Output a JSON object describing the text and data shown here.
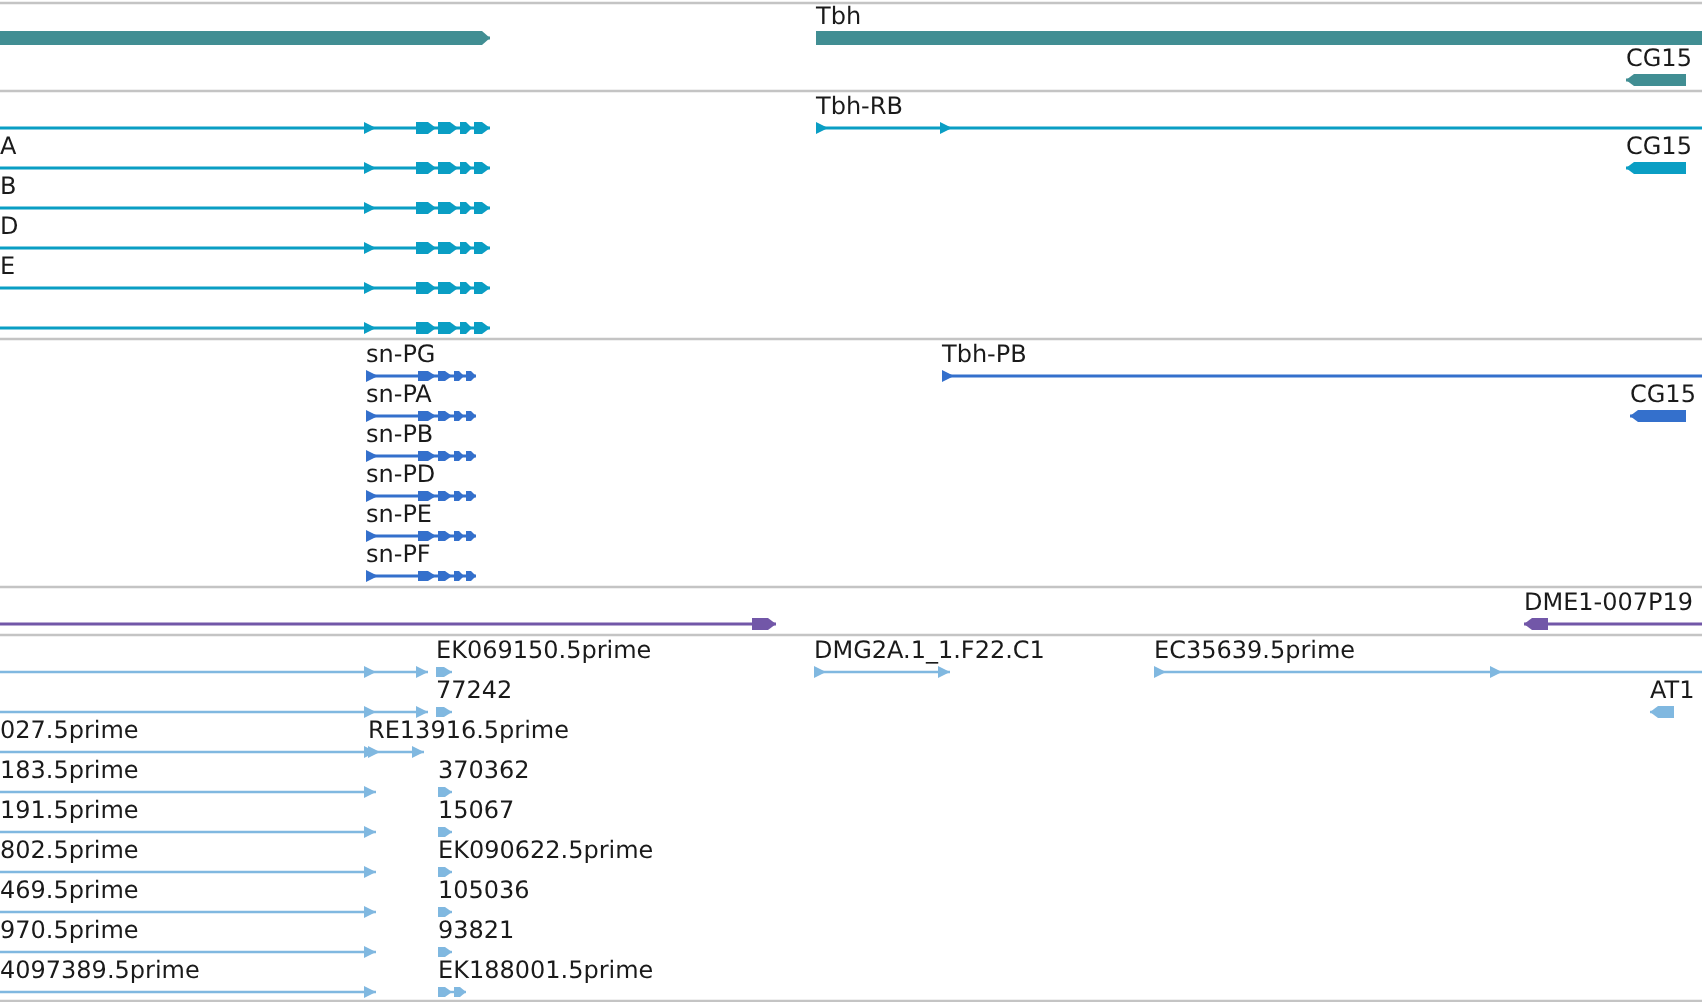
{
  "tracks": [
    {
      "kind": "gene",
      "color": "#418e93",
      "features": [
        {
          "reverse": false
        },
        {
          "label": "Tbh",
          "reverse": false
        },
        {
          "label": "CG15",
          "reverse": true
        }
      ]
    },
    {
      "kind": "transcript",
      "color": "#0a9ec4",
      "features": [
        {
          "reverse": false
        },
        {
          "label": "A",
          "reverse": false
        },
        {
          "label": "B",
          "reverse": false
        },
        {
          "label": "D",
          "reverse": false
        },
        {
          "label": "E",
          "reverse": false
        },
        {
          "reverse": false
        },
        {
          "label": "Tbh-RB",
          "reverse": false
        },
        {
          "label": "CG15",
          "reverse": true
        }
      ]
    },
    {
      "kind": "protein",
      "color": "#3470cc",
      "features": [
        {
          "label": "sn-PG",
          "reverse": false
        },
        {
          "label": "sn-PA",
          "reverse": false
        },
        {
          "label": "sn-PB",
          "reverse": false
        },
        {
          "label": "sn-PD",
          "reverse": false
        },
        {
          "label": "sn-PE",
          "reverse": false
        },
        {
          "label": "sn-PF",
          "reverse": false
        },
        {
          "label": "Tbh-PB",
          "reverse": false
        },
        {
          "label": "CG15",
          "reverse": true
        }
      ]
    },
    {
      "kind": "clone",
      "color": "#7257a8",
      "features": [
        {
          "reverse": false
        },
        {
          "label": "DME1-007P19",
          "reverse": true
        }
      ]
    },
    {
      "kind": "est",
      "color": "#80b8e0",
      "features": [
        {
          "reverse": false
        },
        {
          "label": "EK069150.5prime",
          "reverse": false
        },
        {
          "label": "DMG2A.1_1.F22.C1",
          "reverse": false
        },
        {
          "label": "EC35639.5prime",
          "reverse": false
        },
        {
          "reverse": false
        },
        {
          "label": "77242",
          "reverse": false
        },
        {
          "label": "AT1",
          "reverse": true
        },
        {
          "label": "027.5prime",
          "reverse": false
        },
        {
          "label": "RE13916.5prime",
          "reverse": false
        },
        {
          "label": "183.5prime",
          "reverse": false
        },
        {
          "label": "370362",
          "reverse": false
        },
        {
          "label": "191.5prime",
          "reverse": false
        },
        {
          "label": "15067",
          "reverse": false
        },
        {
          "label": "802.5prime",
          "reverse": false
        },
        {
          "label": "EK090622.5prime",
          "reverse": false
        },
        {
          "label": "469.5prime",
          "reverse": false
        },
        {
          "label": "105036",
          "reverse": false
        },
        {
          "label": "970.5prime",
          "reverse": false
        },
        {
          "label": "93821",
          "reverse": false
        },
        {
          "label": "4097389.5prime",
          "reverse": false
        },
        {
          "label": "EK188001.5prime",
          "reverse": false
        }
      ]
    }
  ]
}
